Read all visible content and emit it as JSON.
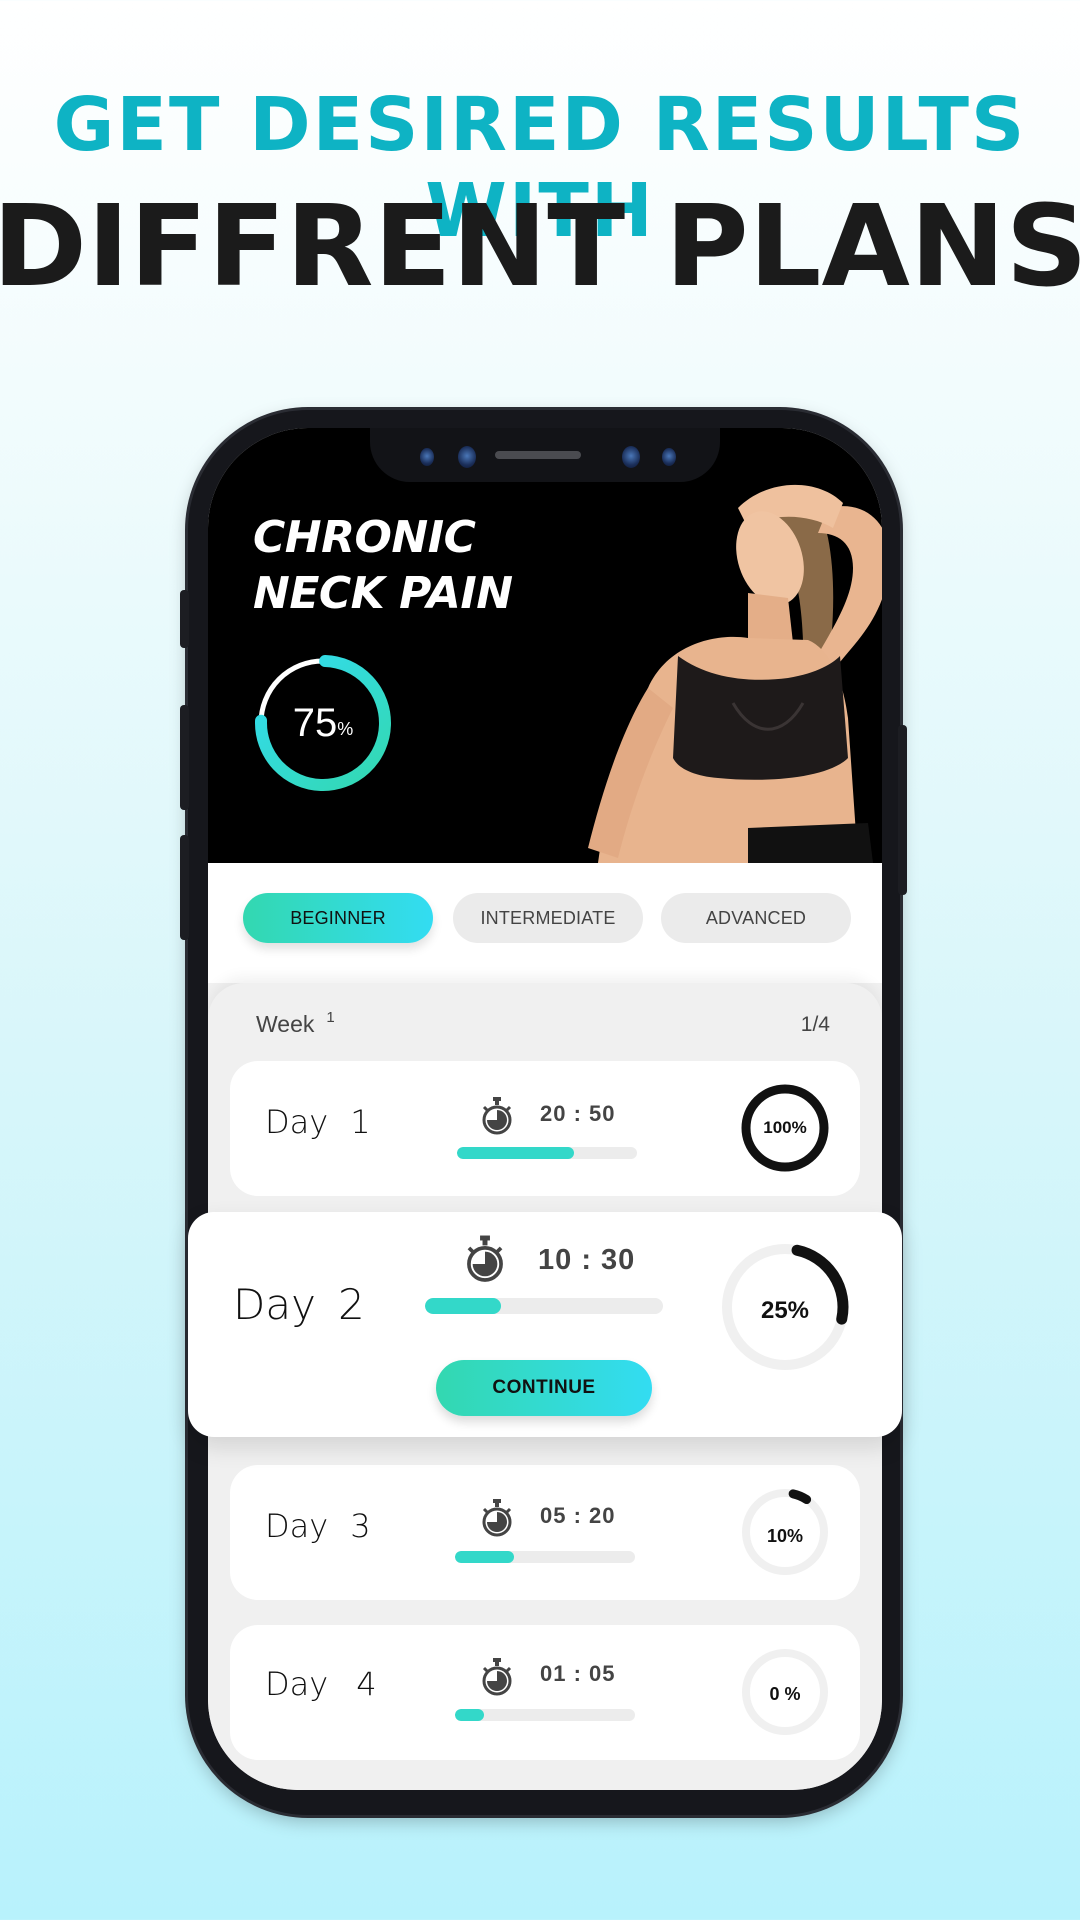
{
  "headline": {
    "top": "GET DESIRED RESULTS WITH",
    "main": "DIFFRENT PLANS"
  },
  "colors": {
    "accent_teal": "#0eb3c4",
    "gradient_start": "#33d8b0",
    "gradient_end": "#33dcf2",
    "progress_fill": "#33d8c9",
    "ring_black": "#111111"
  },
  "hero": {
    "title_line1": "CHRONIC",
    "title_line2": "NECK PAIN",
    "progress_value": "75",
    "progress_unit": "%",
    "progress_fraction": 0.75
  },
  "tabs": [
    {
      "label": "BEGINNER",
      "active": true
    },
    {
      "label": "INTERMEDIATE",
      "active": false
    },
    {
      "label": "ADVANCED",
      "active": false
    }
  ],
  "week": {
    "label": "Week",
    "number": "1",
    "count": "1/4"
  },
  "days": [
    {
      "label": "Day",
      "number": "1",
      "time": "20 : 50",
      "bar_fraction": 0.65,
      "percent_label": "100%",
      "ring_fraction": 1.0
    },
    {
      "label": "Day",
      "number": "2",
      "time": "10 : 30",
      "bar_fraction": 0.32,
      "percent_label": "25%",
      "ring_fraction": 0.25,
      "button": "CONTINUE"
    },
    {
      "label": "Day",
      "number": "3",
      "time": "05 : 20",
      "bar_fraction": 0.33,
      "percent_label": "10%",
      "ring_fraction": 0.1
    },
    {
      "label": "Day",
      "number": "4",
      "time": "01 : 05",
      "bar_fraction": 0.16,
      "percent_label": "0 %",
      "ring_fraction": 0.0
    }
  ],
  "icons": {
    "timer": "stopwatch-icon"
  }
}
